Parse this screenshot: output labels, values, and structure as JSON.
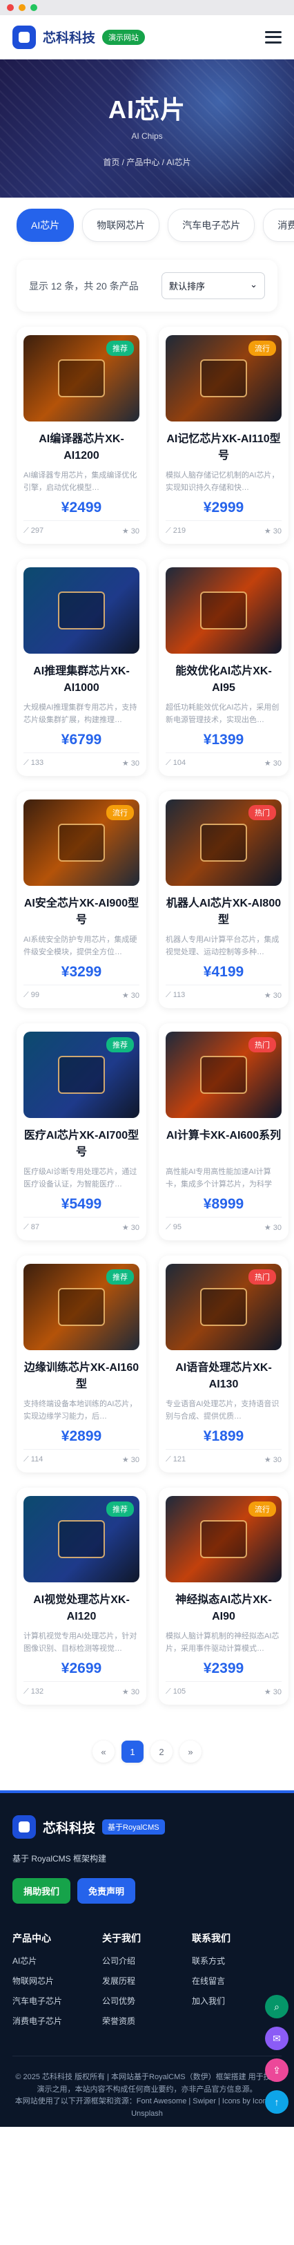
{
  "header": {
    "brand": "芯科科技",
    "badge": "演示网站"
  },
  "hero": {
    "title": "AI芯片",
    "subtitle": "AI Chips",
    "breadcrumb": "首页 / 产品中心 / AI芯片"
  },
  "tabs": [
    "AI芯片",
    "物联网芯片",
    "汽车电子芯片",
    "消费"
  ],
  "toolbar": {
    "summary": "显示 12 条，共 20 条产品",
    "sort": "默认排序"
  },
  "products": [
    {
      "name": "AI编译器芯片XK-AI1200",
      "desc": "AI编译器专用芯片，集成编译优化引擎，启动优化模型…",
      "price": "¥2499",
      "views": "297",
      "likes": "30",
      "tag": "推荐",
      "tagColor": "#10b981"
    },
    {
      "name": "AI记忆芯片XK-AI110型号",
      "desc": "模拟人脑存储记忆机制的AI芯片，实现知识持久存储和快…",
      "price": "¥2999",
      "views": "219",
      "likes": "30",
      "tag": "流行",
      "tagColor": "#f59e0b"
    },
    {
      "name": "AI推理集群芯片XK-AI1000",
      "desc": "大规模AI推理集群专用芯片，支持芯片级集群扩展，构建推理…",
      "price": "¥6799",
      "views": "133",
      "likes": "30",
      "tag": "",
      "tagColor": ""
    },
    {
      "name": "能效优化AI芯片XK-AI95",
      "desc": "超低功耗能效优化AI芯片，采用创新电源管理技术，实现出色…",
      "price": "¥1399",
      "views": "104",
      "likes": "30",
      "tag": "",
      "tagColor": ""
    },
    {
      "name": "AI安全芯片XK-AI900型号",
      "desc": "AI系统安全防护专用芯片，集成硬件级安全模块，提供全方位…",
      "price": "¥3299",
      "views": "99",
      "likes": "30",
      "tag": "流行",
      "tagColor": "#f59e0b"
    },
    {
      "name": "机器人AI芯片XK-AI800型",
      "desc": "机器人专用AI计算平台芯片，集成视觉处理、运动控制等多种…",
      "price": "¥4199",
      "views": "113",
      "likes": "30",
      "tag": "热门",
      "tagColor": "#ef4444"
    },
    {
      "name": "医疗AI芯片XK-AI700型号",
      "desc": "医疗级AI诊断专用处理芯片，通过医疗设备认证，为智能医疗…",
      "price": "¥5499",
      "views": "87",
      "likes": "30",
      "tag": "推荐",
      "tagColor": "#10b981"
    },
    {
      "name": "AI计算卡XK-AI600系列",
      "desc": "高性能AI专用高性能加速AI计算卡，集成多个计算芯片，为科学计…",
      "price": "¥8999",
      "views": "95",
      "likes": "30",
      "tag": "热门",
      "tagColor": "#ef4444"
    },
    {
      "name": "边缘训练芯片XK-AI160型",
      "desc": "支持终端设备本地训练的AI芯片，实现边缘学习能力，后…",
      "price": "¥2899",
      "views": "114",
      "likes": "30",
      "tag": "推荐",
      "tagColor": "#10b981"
    },
    {
      "name": "AI语音处理芯片XK-AI130",
      "desc": "专业语音AI处理芯片，支持语音识别与合成、提供优质…",
      "price": "¥1899",
      "views": "121",
      "likes": "30",
      "tag": "热门",
      "tagColor": "#ef4444"
    },
    {
      "name": "AI视觉处理芯片XK-AI120",
      "desc": "计算机视觉专用AI处理芯片，针对图像识别、目标检测等视觉…",
      "price": "¥2699",
      "views": "132",
      "likes": "30",
      "tag": "推荐",
      "tagColor": "#10b981"
    },
    {
      "name": "神经拟态AI芯片XK-AI90",
      "desc": "模拟人脑计算机制的神经拟态AI芯片，采用事件驱动计算模式…",
      "price": "¥2399",
      "views": "105",
      "likes": "30",
      "tag": "流行",
      "tagColor": "#f59e0b"
    }
  ],
  "pagination": {
    "prev": "«",
    "pages": [
      "1",
      "2"
    ],
    "next": "»"
  },
  "footer": {
    "brand": "芯科科技",
    "badge": "基于RoyalCMS",
    "desc": "基于 RoyalCMS 框架构建",
    "btn1": "捐助我们",
    "btn2": "免责声明",
    "col1": {
      "title": "产品中心",
      "links": [
        "AI芯片",
        "物联网芯片",
        "汽车电子芯片",
        "消费电子芯片"
      ]
    },
    "col2": {
      "title": "关于我们",
      "links": [
        "公司介绍",
        "发展历程",
        "公司优势",
        "荣誉资质"
      ]
    },
    "col3": {
      "title": "联系我们",
      "links": [
        "联系方式",
        "在线留言",
        "加入我们"
      ]
    },
    "copyright": "© 2025 芯科科技 版权所有 | 本网站基于RoyalCMS（数伊）框架搭建 用于技术演示之用，本站内容不构成任何商业要约，亦非产品官方信息源。",
    "credits": "本网站使用了以下开源框架和资源：Font Awesome | Swiper | Icons by Icons8 | Unsplash"
  }
}
